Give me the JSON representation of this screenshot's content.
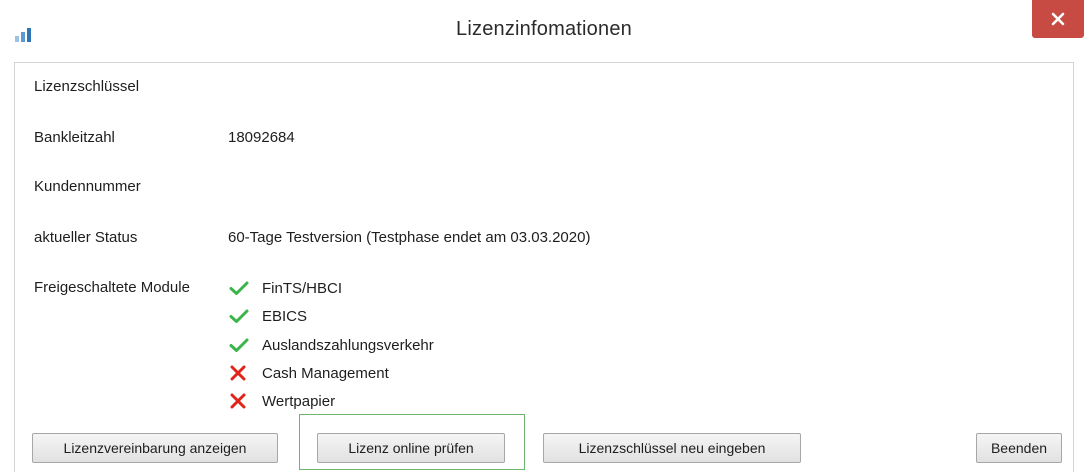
{
  "window": {
    "title": "Lizenzinfomationen"
  },
  "fields": [
    {
      "label": "Lizenzschlüssel",
      "value": ""
    },
    {
      "label": "Bankleitzahl",
      "value": "18092684"
    },
    {
      "label": "Kundennummer",
      "value": ""
    },
    {
      "label": "aktueller Status",
      "value": "60-Tage Testversion (Testphase endet am 03.03.2020)"
    }
  ],
  "modules": {
    "label": "Freigeschaltete Module",
    "items": [
      {
        "name": "FinTS/HBCI",
        "enabled": true
      },
      {
        "name": "EBICS",
        "enabled": true
      },
      {
        "name": "Auslandszahlungsverkehr",
        "enabled": true
      },
      {
        "name": "Cash Management",
        "enabled": false
      },
      {
        "name": "Wertpapier",
        "enabled": false
      }
    ]
  },
  "buttons": {
    "show_agreement": "Lizenzvereinbarung anzeigen",
    "check_online": "Lizenz online prüfen",
    "reenter_key": "Lizenzschlüssel neu eingeben",
    "quit": "Beenden"
  },
  "colors": {
    "check": "#3bb54a",
    "cross": "#e2231a",
    "close_button": "#c74a43",
    "focus_frame": "#6cb56c"
  },
  "icons": {
    "app": "bar-chart-icon",
    "close": "close-icon",
    "enabled": "checkmark-icon",
    "disabled": "cross-icon"
  }
}
